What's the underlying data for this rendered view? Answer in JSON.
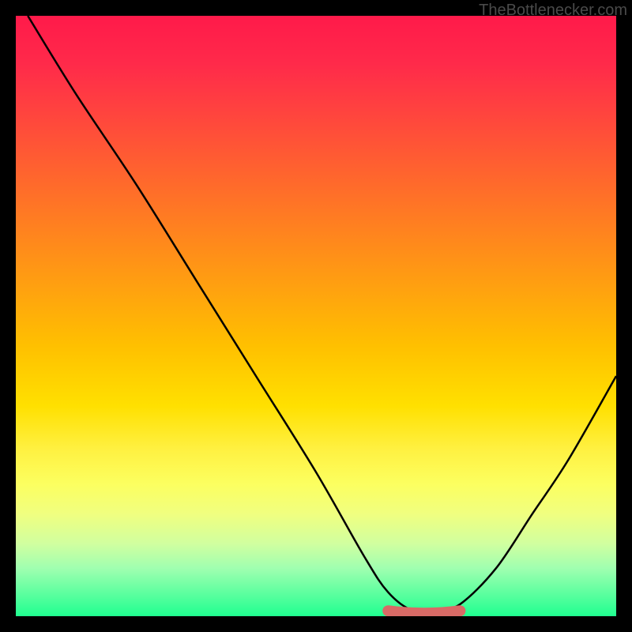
{
  "watermark": "TheBottlenecker.com",
  "chart_data": {
    "type": "line",
    "title": "",
    "xlabel": "",
    "ylabel": "",
    "xlim": [
      0,
      100
    ],
    "ylim": [
      0,
      100
    ],
    "series": [
      {
        "name": "bottleneck-curve",
        "x": [
          2,
          10,
          20,
          30,
          40,
          50,
          58,
          62,
          66,
          70,
          74,
          80,
          86,
          92,
          100
        ],
        "values": [
          100,
          87,
          72,
          56,
          40,
          24,
          10,
          4,
          1,
          1,
          2,
          8,
          17,
          26,
          40
        ]
      }
    ],
    "optimal_range": {
      "x_start": 62,
      "x_end": 74,
      "y": 0.5
    },
    "color_scale": {
      "top": "#ff1a4a",
      "mid": "#ffe000",
      "bottom": "#20ff90"
    }
  }
}
